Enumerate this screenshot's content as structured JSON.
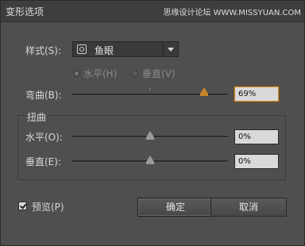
{
  "window": {
    "title": "变形选项",
    "watermark": "思缘设计论坛 WWW.MISSYUAN.COM"
  },
  "style_row": {
    "label": "样式(S):",
    "selected": "鱼眼",
    "icon": "warp-style-icon"
  },
  "orientation": {
    "horizontal_label": "水平(H)",
    "vertical_label": "垂直(V)",
    "selected": "horizontal"
  },
  "bend": {
    "label": "弯曲(B):",
    "value_text": "69%",
    "value": 69
  },
  "distortion": {
    "group_label": "扭曲",
    "horizontal": {
      "label": "水平(O):",
      "value_text": "0%",
      "value": 0
    },
    "vertical": {
      "label": "垂直(E):",
      "value_text": "0%",
      "value": 0
    }
  },
  "preview": {
    "label": "预览(P)",
    "checked": true
  },
  "buttons": {
    "ok": "确定",
    "cancel": "取消"
  },
  "colors": {
    "accent": "#c9852b",
    "background": "#4f4f4f"
  }
}
